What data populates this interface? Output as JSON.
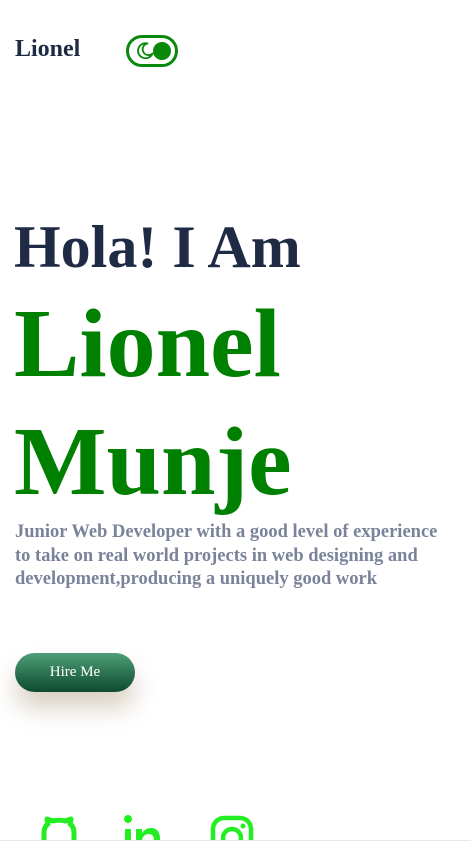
{
  "header": {
    "brand": "Lionel",
    "theme_toggle_icon": "moon-icon",
    "accent_color": "#008000"
  },
  "hero": {
    "greeting": "Hola! I Am",
    "first_name": "Lionel",
    "last_name": "Munje",
    "bio": "Junior Web Developer with a good level of experience to take on real world projects in web designing and development,producing a uniquely good work",
    "hire_button": "Hire Me"
  },
  "socials": [
    {
      "icon": "github-icon"
    },
    {
      "icon": "linkedin-icon"
    },
    {
      "icon": "instagram-icon"
    }
  ],
  "colors": {
    "heading": "#1f2a44",
    "name": "#008000",
    "bio": "#7a8399",
    "social": "#22ee22"
  }
}
